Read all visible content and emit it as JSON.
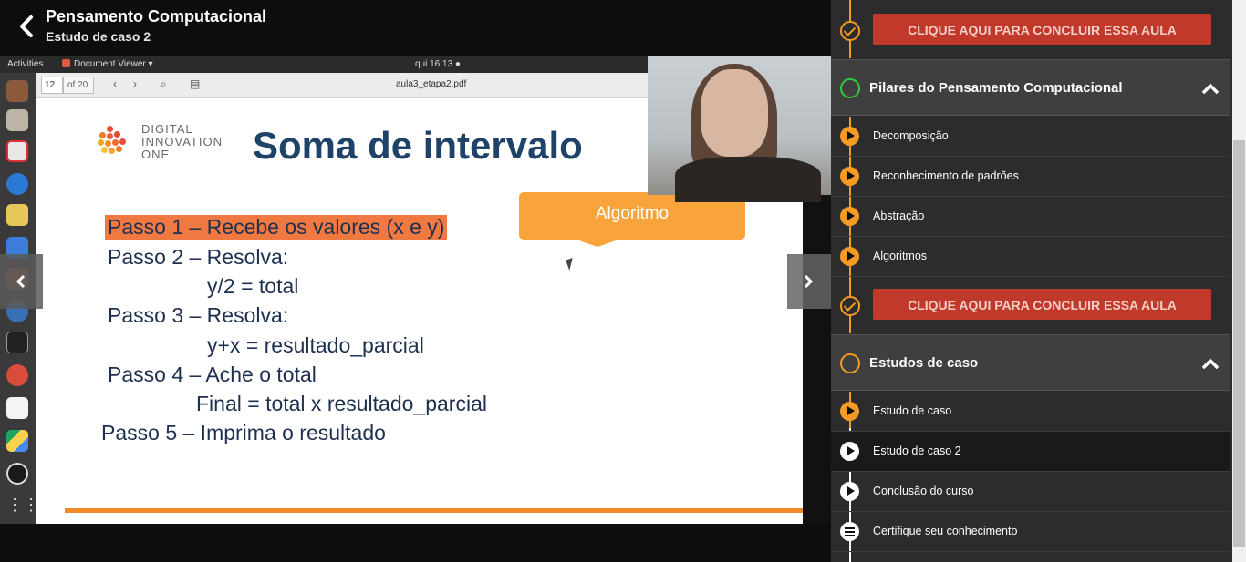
{
  "header": {
    "course_title": "Pensamento Computacional",
    "lesson_title": "Estudo de caso 2"
  },
  "video": {
    "desktop_bar": {
      "activities": "Activities",
      "app": "Document Viewer ▾",
      "clock": "qui 16:13 ●"
    },
    "viewer": {
      "page": "12",
      "page_of": "of 20",
      "filename": "aula3_etapa2.pdf"
    },
    "slide": {
      "logo_line1": "DIGITAL",
      "logo_line2": "INNOVATION",
      "logo_line3": "ONE",
      "title": "Soma de intervalo",
      "callout": "Algoritmo",
      "steps": [
        "Passo 1 – Recebe os valores (x e y)",
        "Passo 2 – Resolva:",
        "y/2 = total",
        "Passo 3 – Resolva:",
        "y+x = resultado_parcial",
        "Passo 4 – Ache o total",
        "Final = total x resultado_parcial",
        "Passo 5 – Imprima o resultado"
      ]
    }
  },
  "sidebar": {
    "complete_label_1": "CLIQUE AQUI PARA CONCLUIR ESSA AULA",
    "complete_label_2": "CLIQUE AQUI PARA CONCLUIR ESSA AULA",
    "sections": [
      {
        "title": "Pilares do Pensamento Computacional",
        "items": [
          "Decomposição",
          "Reconhecimento de padrões",
          "Abstração",
          "Algoritmos"
        ]
      },
      {
        "title": "Estudos de caso",
        "items": [
          "Estudo de caso",
          "Estudo de caso 2",
          "Conclusão do curso",
          "Certifique seu conhecimento"
        ]
      }
    ]
  },
  "colors": {
    "accent_orange": "#f59a23",
    "complete_button": "#c0392b",
    "slide_title": "#1e4268",
    "callout": "#f9a43a",
    "check_green": "#2ecc40"
  }
}
